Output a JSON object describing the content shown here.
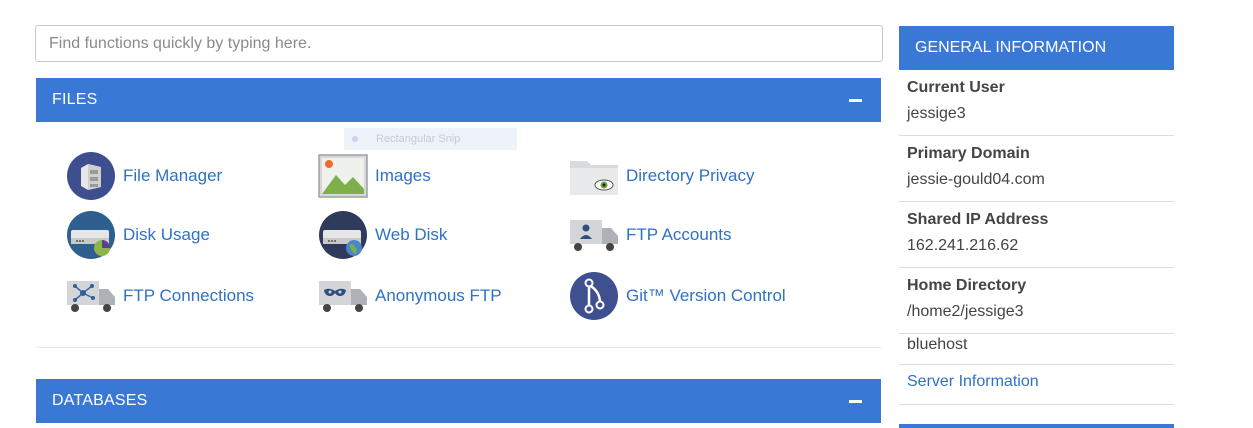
{
  "search": {
    "placeholder": "Find functions quickly by typing here."
  },
  "files": {
    "title": "FILES",
    "tools": [
      {
        "label": "File Manager",
        "icon": "file-manager-icon"
      },
      {
        "label": "Images",
        "icon": "images-icon"
      },
      {
        "label": "Directory Privacy",
        "icon": "directory-privacy-icon"
      },
      {
        "label": "Disk Usage",
        "icon": "disk-usage-icon"
      },
      {
        "label": "Web Disk",
        "icon": "web-disk-icon"
      },
      {
        "label": "FTP Accounts",
        "icon": "ftp-accounts-icon"
      },
      {
        "label": "FTP Connections",
        "icon": "ftp-connections-icon"
      },
      {
        "label": "Anonymous FTP",
        "icon": "anonymous-ftp-icon"
      },
      {
        "label": "Git™ Version Control",
        "icon": "git-version-control-icon"
      }
    ]
  },
  "snip_overlay": {
    "label": "Rectangular Snip"
  },
  "databases": {
    "title": "DATABASES"
  },
  "general_info": {
    "title": "GENERAL INFORMATION",
    "current_user_label": "Current User",
    "current_user": "jessige3",
    "primary_domain_label": "Primary Domain",
    "primary_domain": "jessie-gould04.com",
    "shared_ip_label": "Shared IP Address",
    "shared_ip": "162.241.216.62",
    "home_dir_label": "Home Directory",
    "home_dir": "/home2/jessige3",
    "host": "bluehost",
    "server_info_link": "Server Information"
  },
  "colors": {
    "header_blue": "#3a78d6",
    "link_blue": "#2f72c4"
  }
}
